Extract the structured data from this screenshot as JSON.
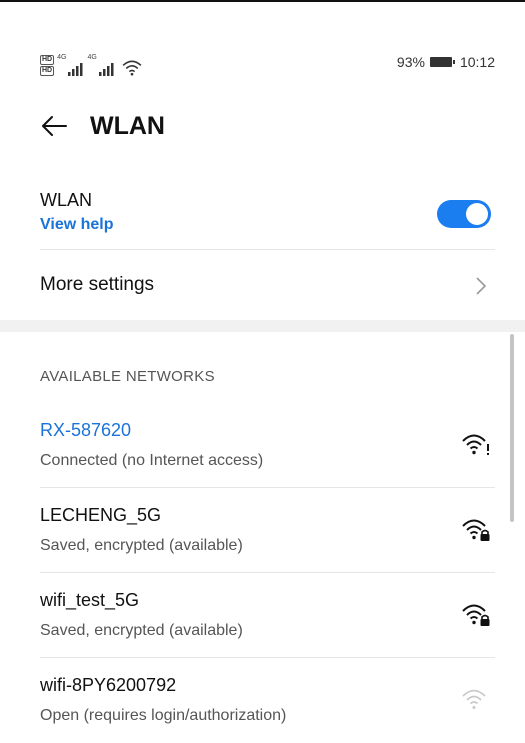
{
  "status_bar": {
    "hd_top": "HD",
    "hd_bottom": "HD",
    "net1": "4G",
    "net2": "4G",
    "battery_percent": "93%",
    "time": "10:12",
    "icons": [
      "hd-volte-icon",
      "signal-icon",
      "signal-icon",
      "wifi-icon",
      "battery-icon"
    ]
  },
  "header": {
    "title": "WLAN",
    "back_icon": "back-arrow-icon"
  },
  "wlan": {
    "label": "WLAN",
    "help_link": "View help",
    "enabled": true,
    "accent_color": "#1a7df0"
  },
  "more_settings": {
    "label": "More settings",
    "icon": "chevron-right-icon"
  },
  "available": {
    "header": "AVAILABLE NETWORKS",
    "networks": [
      {
        "ssid": "RX-587620",
        "status": "Connected (no Internet access)",
        "connected": true,
        "icon": "wifi-no-internet-icon"
      },
      {
        "ssid": "LECHENG_5G",
        "status": "Saved, encrypted (available)",
        "connected": false,
        "icon": "wifi-lock-icon"
      },
      {
        "ssid": "wifi_test_5G",
        "status": "Saved, encrypted (available)",
        "connected": false,
        "icon": "wifi-lock-icon"
      },
      {
        "ssid": "wifi-8PY6200792",
        "status": "Open (requires login/authorization)",
        "connected": false,
        "icon": "wifi-weak-icon"
      }
    ]
  }
}
